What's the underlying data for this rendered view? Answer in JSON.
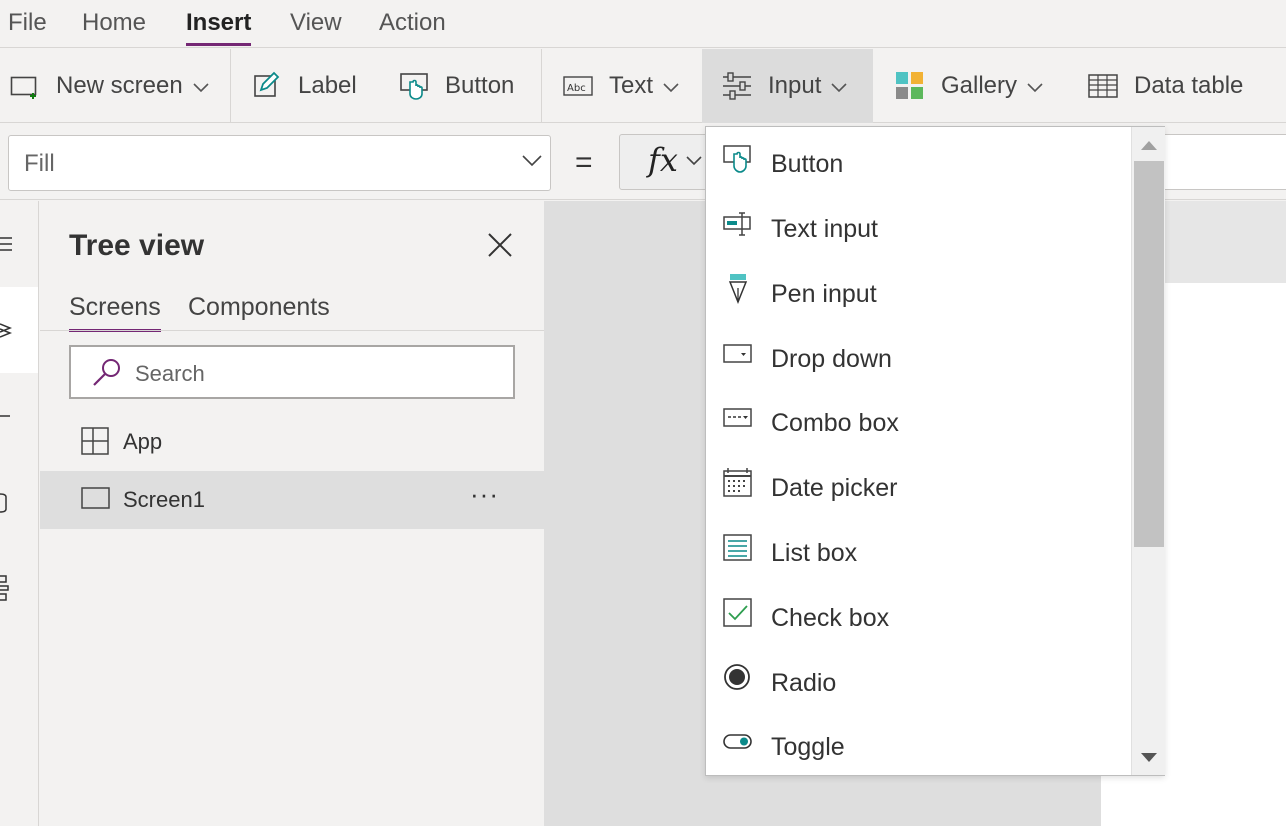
{
  "menu": {
    "tabs": [
      {
        "label": "File"
      },
      {
        "label": "Home"
      },
      {
        "label": "Insert"
      },
      {
        "label": "View"
      },
      {
        "label": "Action"
      }
    ],
    "active": "Insert"
  },
  "ribbon": {
    "new_screen": "New screen",
    "label": "Label",
    "button": "Button",
    "text": "Text",
    "input": "Input",
    "gallery": "Gallery",
    "data_table": "Data table"
  },
  "formula": {
    "property": "Fill",
    "equals": "=",
    "fx": "fx"
  },
  "tree": {
    "title": "Tree view",
    "tabs": [
      "Screens",
      "Components"
    ],
    "search_placeholder": "Search",
    "items": [
      {
        "label": "App",
        "icon": "app-icon"
      },
      {
        "label": "Screen1",
        "icon": "screen-icon",
        "more": "···"
      }
    ]
  },
  "input_menu": {
    "items": [
      {
        "label": "Button",
        "icon": "button-icon"
      },
      {
        "label": "Text input",
        "icon": "text-input-icon"
      },
      {
        "label": "Pen input",
        "icon": "pen-input-icon"
      },
      {
        "label": "Drop down",
        "icon": "drop-down-icon"
      },
      {
        "label": "Combo box",
        "icon": "combo-box-icon"
      },
      {
        "label": "Date picker",
        "icon": "date-picker-icon"
      },
      {
        "label": "List box",
        "icon": "list-box-icon"
      },
      {
        "label": "Check box",
        "icon": "check-box-icon"
      },
      {
        "label": "Radio",
        "icon": "radio-icon"
      },
      {
        "label": "Toggle",
        "icon": "toggle-icon"
      }
    ]
  },
  "colors": {
    "accent": "#742774",
    "teal": "#0b8a8a",
    "teal_light": "#4fc3c3"
  }
}
